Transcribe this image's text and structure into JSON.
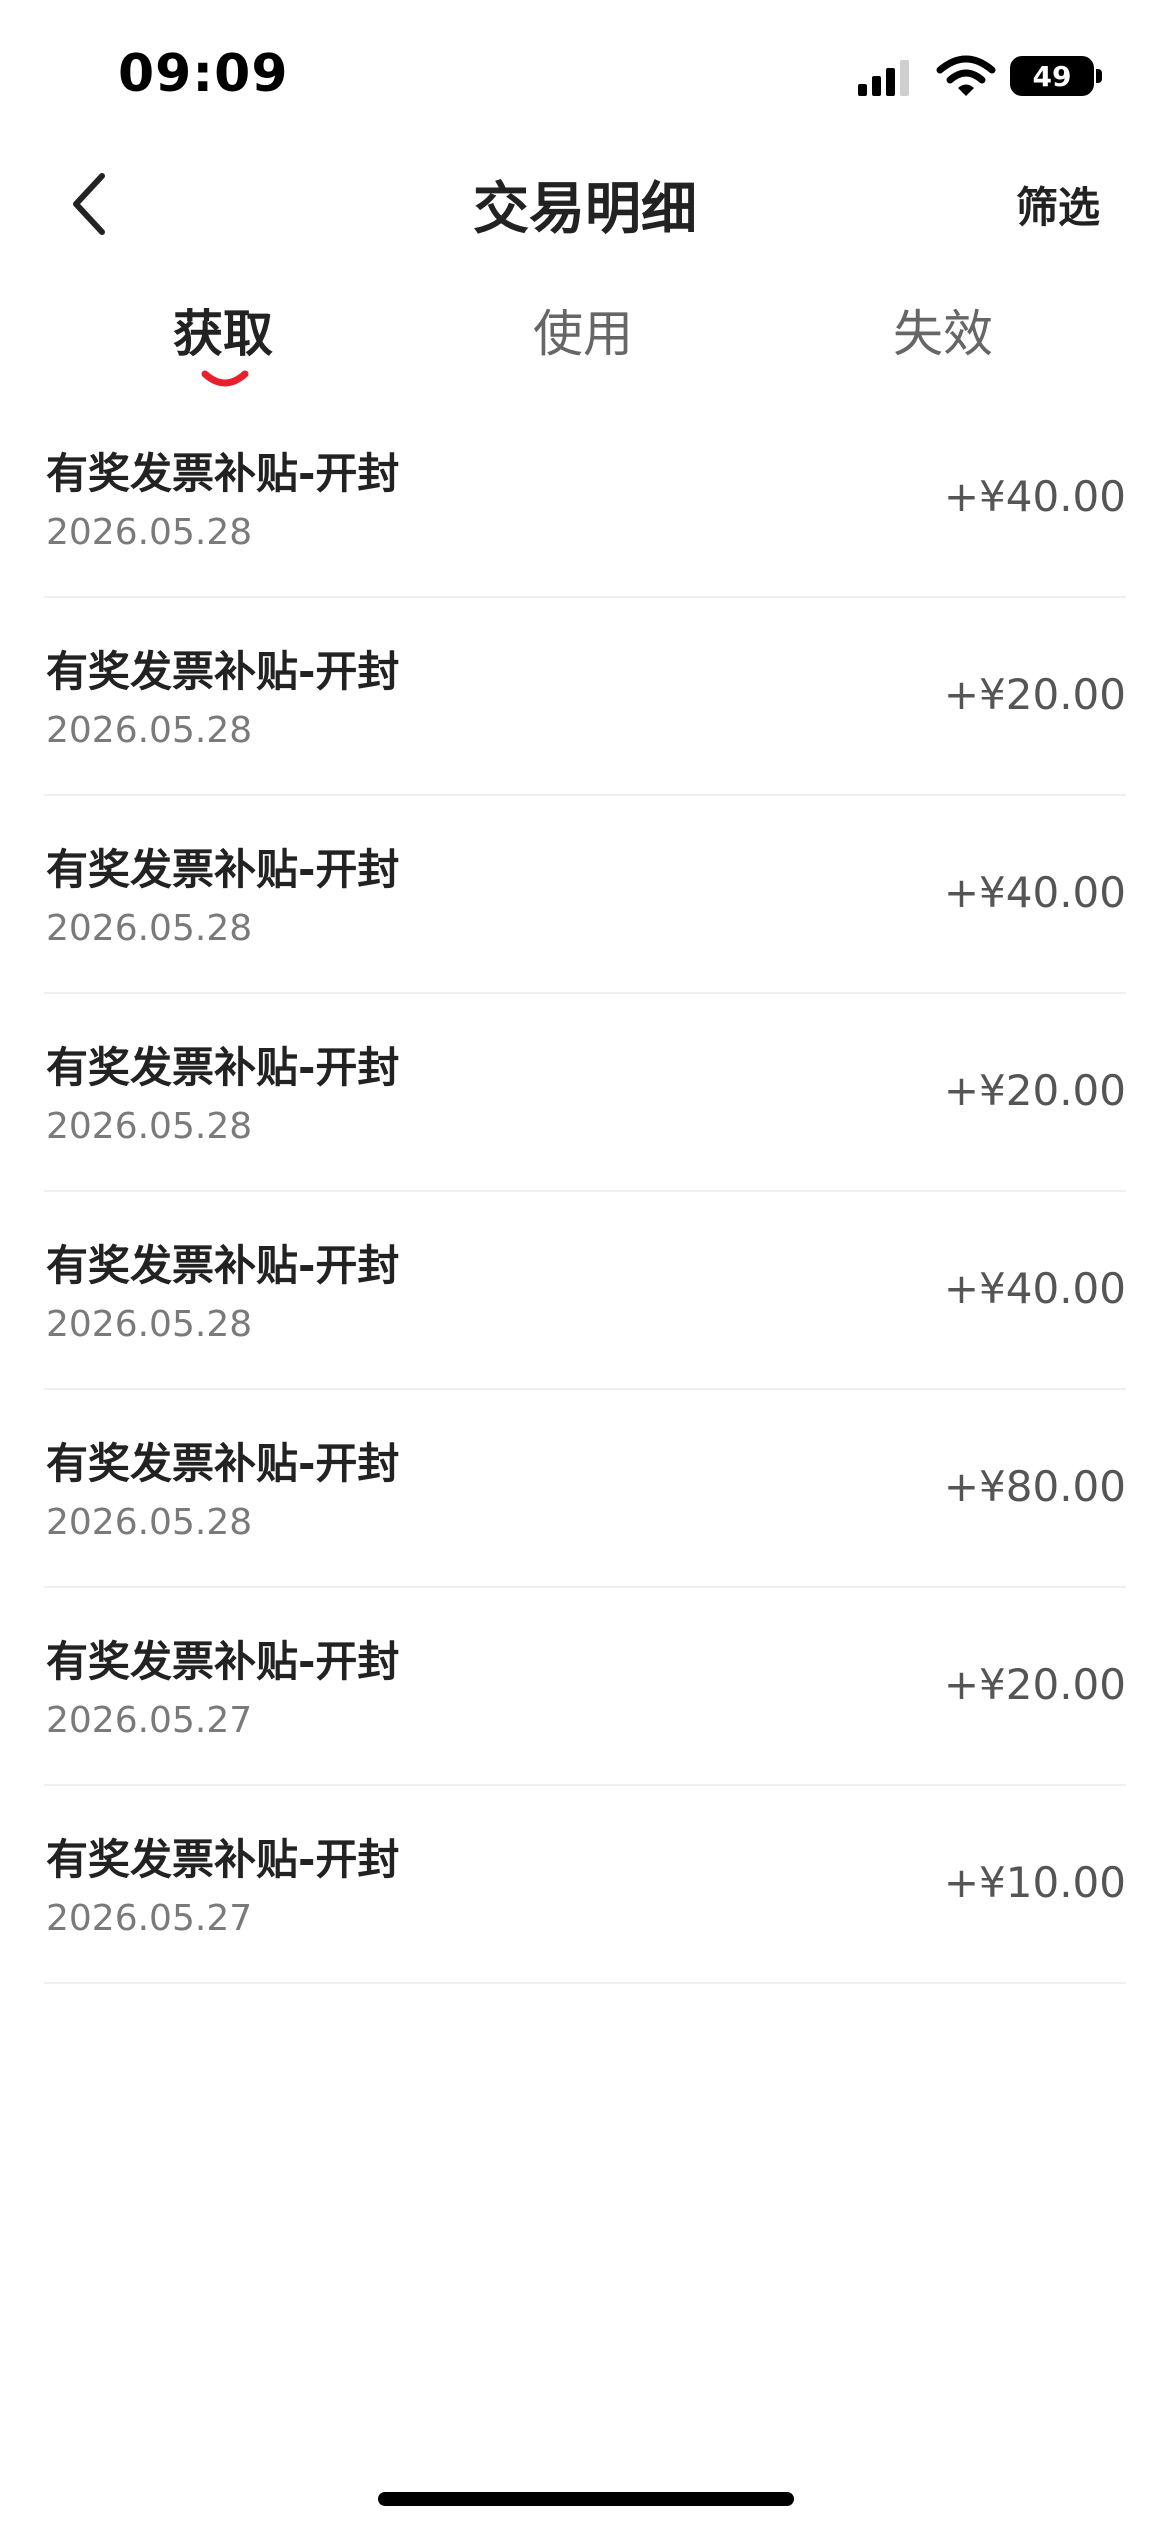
{
  "status_bar": {
    "time": "09:09",
    "battery": "49"
  },
  "nav": {
    "title": "交易明细",
    "filter_label": "筛选"
  },
  "tabs": [
    {
      "label": "获取",
      "active": true
    },
    {
      "label": "使用",
      "active": false
    },
    {
      "label": "失效",
      "active": false
    }
  ],
  "accent_color": "#e8202e",
  "transactions": [
    {
      "title": "有奖发票补贴-开封",
      "date": "2026.05.28",
      "amount": "+¥40.00"
    },
    {
      "title": "有奖发票补贴-开封",
      "date": "2026.05.28",
      "amount": "+¥20.00"
    },
    {
      "title": "有奖发票补贴-开封",
      "date": "2026.05.28",
      "amount": "+¥40.00"
    },
    {
      "title": "有奖发票补贴-开封",
      "date": "2026.05.28",
      "amount": "+¥20.00"
    },
    {
      "title": "有奖发票补贴-开封",
      "date": "2026.05.28",
      "amount": "+¥40.00"
    },
    {
      "title": "有奖发票补贴-开封",
      "date": "2026.05.28",
      "amount": "+¥80.00"
    },
    {
      "title": "有奖发票补贴-开封",
      "date": "2026.05.27",
      "amount": "+¥20.00"
    },
    {
      "title": "有奖发票补贴-开封",
      "date": "2026.05.27",
      "amount": "+¥10.00"
    }
  ]
}
